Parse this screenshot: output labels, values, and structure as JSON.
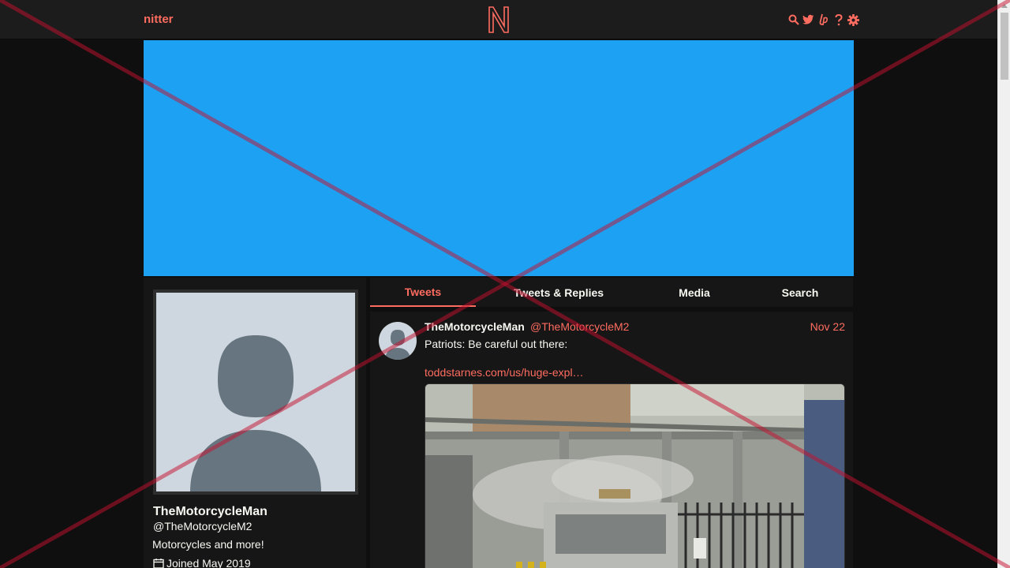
{
  "navbar": {
    "brand": "nitter",
    "logo_letter": "N",
    "icons": [
      "search-icon",
      "twitter-bird-icon",
      "liberapay-icon",
      "help-icon",
      "settings-gear-icon"
    ]
  },
  "colors": {
    "accent": "#ff6c60",
    "banner": "#1da1f2",
    "background": "#0f0f0f",
    "panel": "#161616",
    "navbar": "#1c1c1c",
    "avatar_placeholder": "#ced7df",
    "avatar_silhouette": "#66757f",
    "overlay_cross": "#c8102e"
  },
  "profile": {
    "fullname": "TheMotorcycleMan",
    "username": "@TheMotorcycleM2",
    "bio": "Motorcycles and more!",
    "joined": "Joined May 2019"
  },
  "tabs": [
    {
      "label": "Tweets",
      "active": true
    },
    {
      "label": "Tweets & Replies",
      "active": false
    },
    {
      "label": "Media",
      "active": false
    },
    {
      "label": "Search",
      "active": false
    }
  ],
  "tweet": {
    "fullname": "TheMotorcycleMan",
    "username": "@TheMotorcycleM2",
    "date": "Nov 22",
    "text": "Patriots: Be careful out there:",
    "link": "toddstarnes.com/us/huge-expl…"
  }
}
